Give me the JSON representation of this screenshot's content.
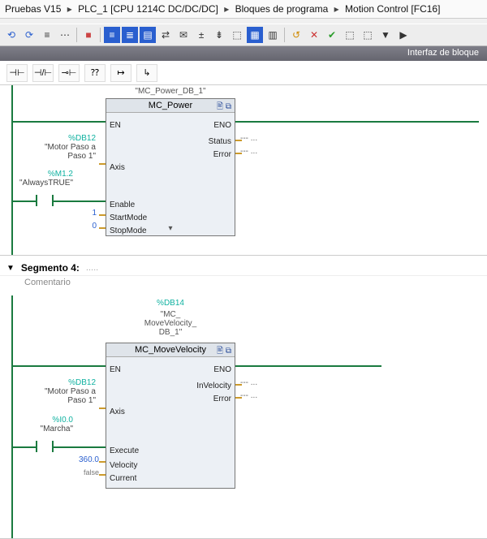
{
  "breadcrumb": {
    "items": [
      "Pruebas V15",
      "PLC_1 [CPU 1214C DC/DC/DC]",
      "Bloques de programa",
      "Motion Control [FC16]"
    ]
  },
  "interface_label": "Interfaz de bloque",
  "ladder_tools": [
    "⊣⊢",
    "⊣/⊢",
    "⊸⊢",
    "⁇",
    "↦",
    "↳"
  ],
  "network1": {
    "instance_db": "\"MC_Power_DB_1\"",
    "block_title": "MC_Power",
    "pins_left": {
      "en": "EN",
      "axis": "Axis",
      "enable": "Enable",
      "startmode": "StartMode",
      "stopmode": "StopMode"
    },
    "pins_right": {
      "eno": "ENO",
      "status": "Status",
      "error": "Error"
    },
    "axis_tag": {
      "addr": "%DB12",
      "sym": "\"Motor Paso a\nPaso 1\""
    },
    "enable_tag": {
      "addr": "%M1.2",
      "sym": "\"AlwaysTRUE\""
    },
    "startmode_val": "1",
    "stopmode_val": "0",
    "dots": "--- ..."
  },
  "segment_header": {
    "title": "Segmento 4:",
    "comment": "Comentario"
  },
  "network2": {
    "instance_addr": "%DB14",
    "instance_sym": "\"MC_\nMoveVelocity_\nDB_1\"",
    "block_title": "MC_MoveVelocity",
    "pins_left": {
      "en": "EN",
      "axis": "Axis",
      "execute": "Execute",
      "velocity": "Velocity",
      "current": "Current"
    },
    "pins_right": {
      "eno": "ENO",
      "invelocity": "InVelocity",
      "error": "Error"
    },
    "axis_tag": {
      "addr": "%DB12",
      "sym": "\"Motor Paso a\nPaso 1\""
    },
    "execute_tag": {
      "addr": "%I0.0",
      "sym": "\"Marcha\""
    },
    "velocity_val": "360.0",
    "current_val": "false",
    "dots": "--- ..."
  }
}
